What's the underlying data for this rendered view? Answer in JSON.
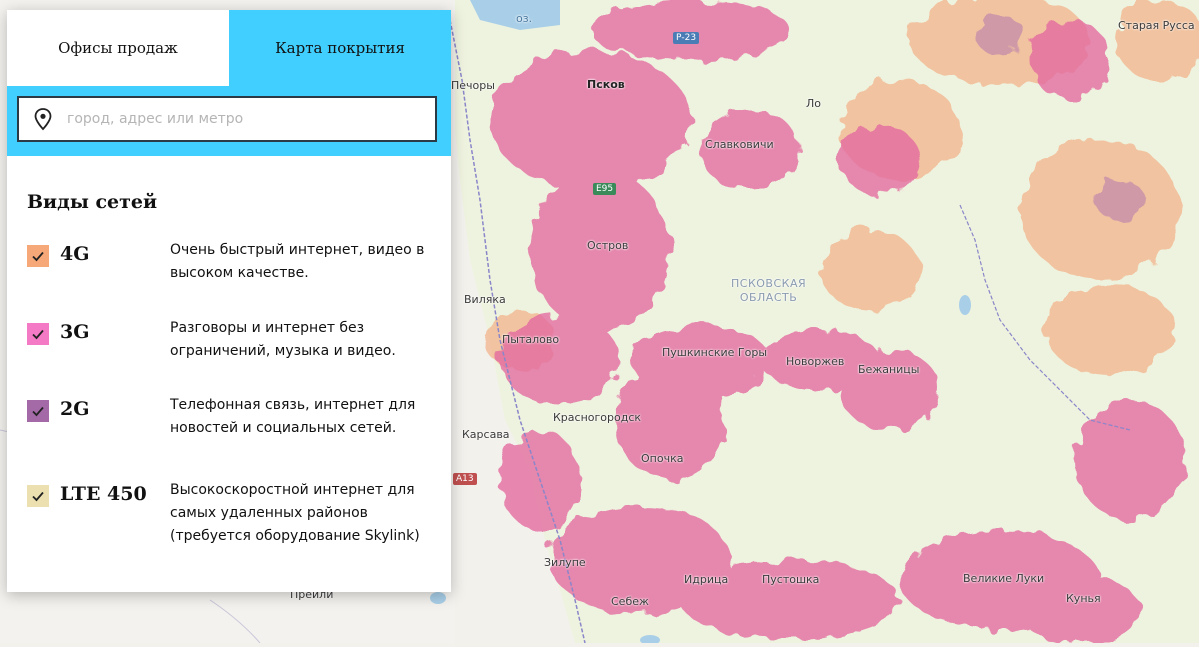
{
  "tabs": [
    {
      "label": "Офисы продаж",
      "active": false
    },
    {
      "label": "Карта покрытия",
      "active": true
    }
  ],
  "search": {
    "placeholder": "город, адрес или метро",
    "value": ""
  },
  "networks": {
    "title": "Виды сетей",
    "items": [
      {
        "name": "4G",
        "description": "Очень быстрый интернет, видео в высоком качестве.",
        "color": "#f7a878",
        "checked": true
      },
      {
        "name": "3G",
        "description": "Разговоры и интернет без ограничений, музыка и видео.",
        "color": "#f57ac6",
        "checked": true
      },
      {
        "name": "2G",
        "description": "Телефонная связь, интернет для новостей и социальных сетей.",
        "color": "#a46aa8",
        "checked": true
      },
      {
        "name": "LTE 450",
        "description": "Высокоскоростной интернет для самых удаленных районов (требуется оборудование Skylink)",
        "color": "#ece0b0",
        "checked": true
      }
    ]
  },
  "map": {
    "region_label": "ПСКОВСКАЯ\nОБЛАСТЬ",
    "places": [
      "Печоры",
      "Псков",
      "Славковичи",
      "Ло",
      "Старая Русса",
      "Остров",
      "Виляка",
      "Пыталово",
      "Пушкинские Горы",
      "Новоржев",
      "Бежаницы",
      "Красногородск",
      "Карсава",
      "Опочка",
      "Зилупе",
      "Идрица",
      "Пустошка",
      "Великие Луки",
      "Себеж",
      "Прейли",
      "Кунья",
      "оз."
    ],
    "roads": [
      "Р-23",
      "Е95",
      "А13"
    ],
    "colors": {
      "coverage_3g": "#e46aa0",
      "coverage_4g": "#f2b48c",
      "land": "#eef3df",
      "water": "#a9cfe8",
      "border": "#8a86c9"
    }
  }
}
